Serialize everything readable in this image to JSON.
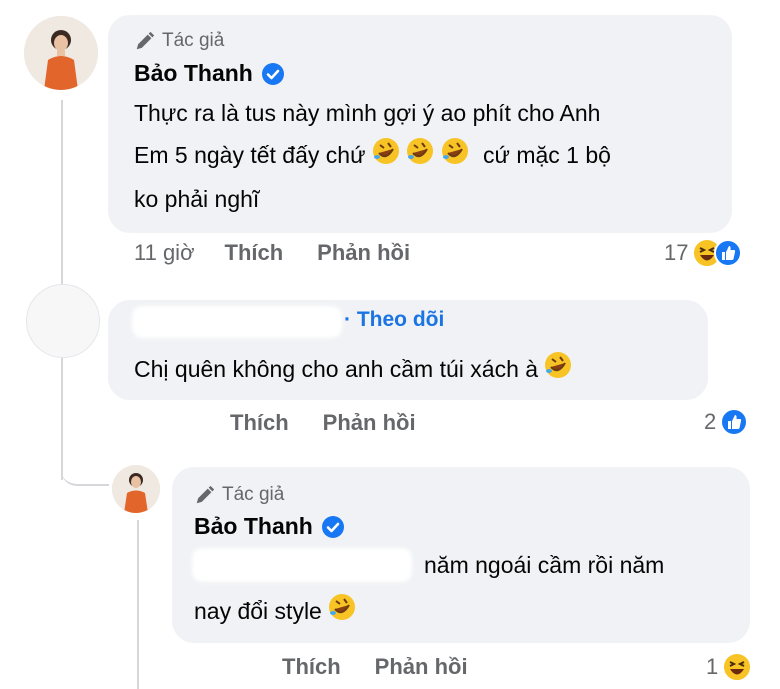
{
  "comments": [
    {
      "author_tag": "Tác giả",
      "author_name": "Bảo Thanh",
      "text_lines": [
        "Thực ra là tus này mình gợi ý ao phít cho Anh",
        "Em 5 ngày tết đấy chứ",
        "cứ mặc 1 bộ",
        "ko phải nghĩ"
      ],
      "time": "11 giờ",
      "like_label": "Thích",
      "reply_label": "Phản hồi",
      "reaction_count": "17"
    },
    {
      "follow_label": "Theo dõi",
      "text": "Chị quên không cho anh cầm túi xách à",
      "like_label": "Thích",
      "reply_label": "Phản hồi",
      "reaction_count": "2"
    },
    {
      "author_tag": "Tác giả",
      "author_name": "Bảo Thanh",
      "text_line1": "năm ngoái cầm rồi năm",
      "text_line2": "nay đổi style",
      "like_label": "Thích",
      "reply_label": "Phản hồi",
      "reaction_count": "1"
    }
  ],
  "colors": {
    "bubble": "#f0f2f5",
    "muted": "#65676b",
    "link": "#1b74e4",
    "verified": "#1877f2"
  }
}
